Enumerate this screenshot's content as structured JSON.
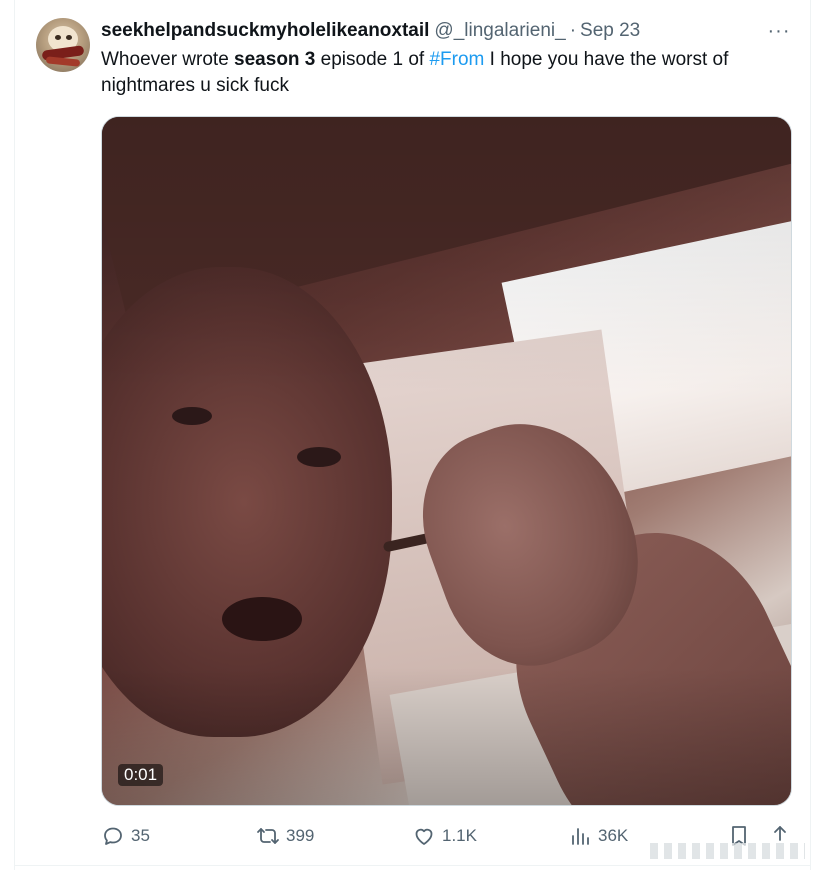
{
  "tweet": {
    "display_name": "seekhelpandsuckmyholelikeanoxtail",
    "handle": "@_lingalarieni_",
    "separator": "·",
    "date": "Sep 23",
    "more_label": "···",
    "text_part1": "Whoever wrote ",
    "text_bold": "season 3",
    "text_part2": " episode 1 of ",
    "text_hashtag": "#From",
    "text_part3": " I hope you have the worst of nightmares u sick fuck"
  },
  "media": {
    "type": "video",
    "duration": "0:01"
  },
  "actions": {
    "replies": "35",
    "retweets": "399",
    "likes": "1.1K",
    "views": "36K"
  },
  "icons": {
    "reply": "reply-icon",
    "retweet": "retweet-icon",
    "like": "heart-icon",
    "views": "views-chart-icon",
    "bookmark": "bookmark-icon",
    "share": "share-icon",
    "more": "more-icon"
  },
  "colors": {
    "text": "#0f1419",
    "secondary": "#536471",
    "link": "#1d9bf0",
    "border": "#cfd9de"
  }
}
